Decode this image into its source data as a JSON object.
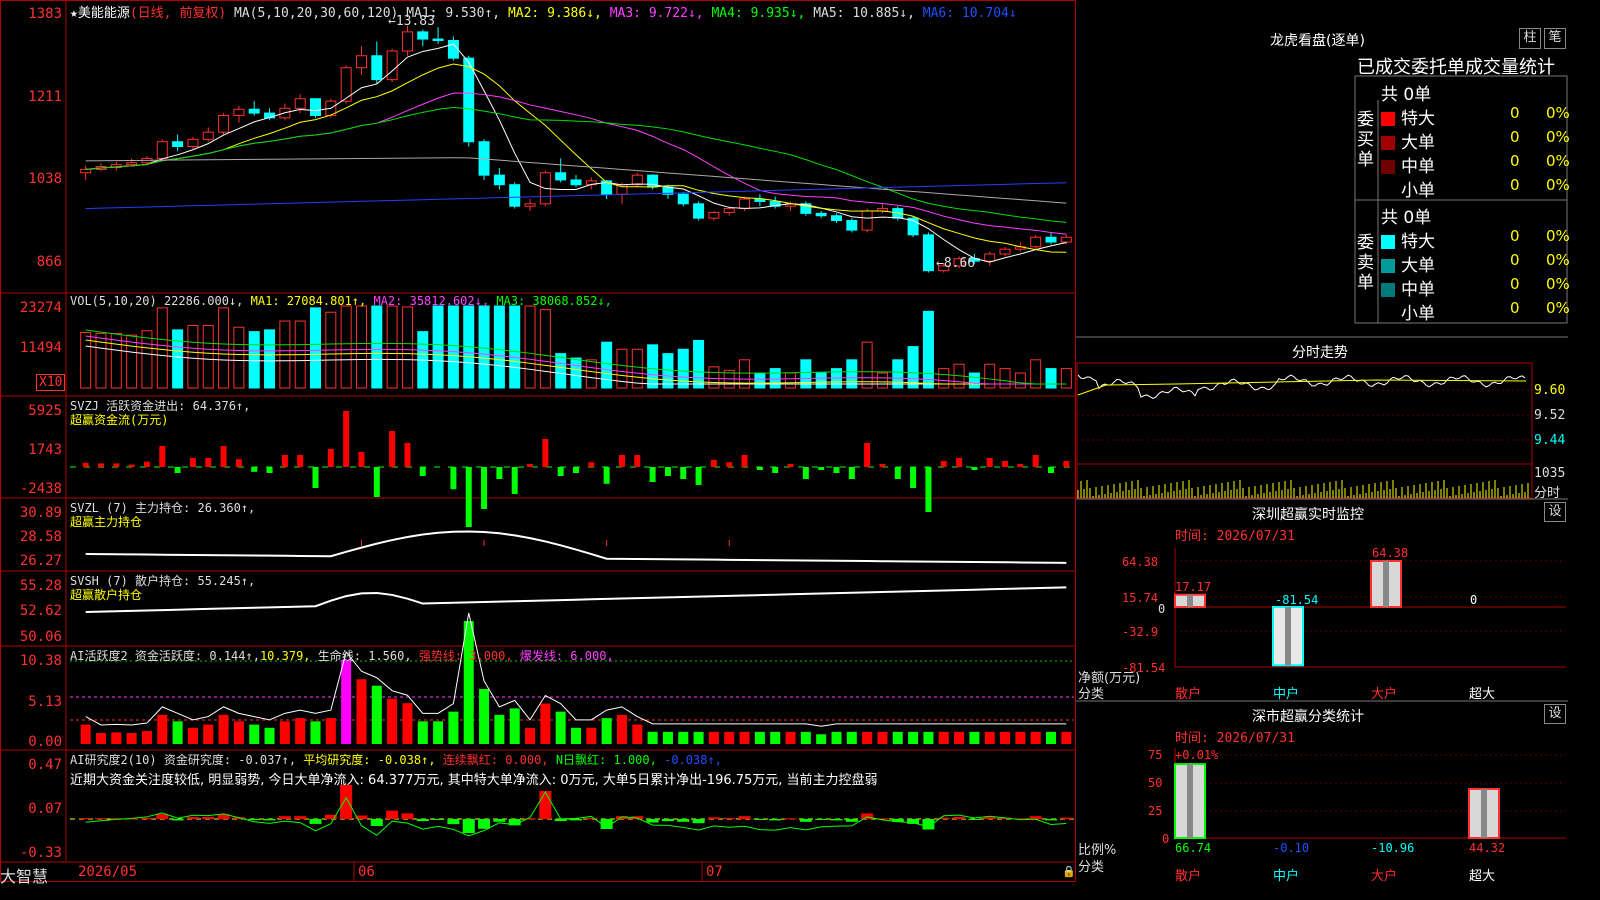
{
  "stock": {
    "name": "美能能源",
    "period": "(日线, 前复权)",
    "ma_caption": "MA(5,10,20,30,60,120)",
    "ma1": "MA1: 9.530↑,",
    "ma2": "MA2: 9.386↓,",
    "ma3": "MA3: 9.722↓,",
    "ma4": "MA4: 9.935↓,",
    "ma5": "MA5: 10.885↓,",
    "ma6": "MA6: 10.704↓",
    "high_mark": "13.83",
    "low_mark": "8.66"
  },
  "price_axis": [
    "1383",
    "1211",
    "1038",
    "866"
  ],
  "vol": {
    "caption": "VOL(5,10,20)",
    "value": "22286.000↓,",
    "ma1": "MA1: 27084.801↑,",
    "ma2": "MA2: 35812.602↓,",
    "ma3": "MA3: 38068.852↓,",
    "axis": [
      "23274",
      "11494"
    ],
    "unit": "X10"
  },
  "svzj": {
    "caption": "SVZJ",
    "title": "活跃资金进出: 64.376↑,",
    "subtitle": "超赢资金流(万元)",
    "axis": [
      "5925",
      "1743",
      "-2438"
    ]
  },
  "svzl": {
    "caption": "SVZL (7)",
    "title": "主力持仓: 26.360↑,",
    "subtitle": "超赢主力持仓",
    "axis": [
      "30.89",
      "28.58",
      "26.27"
    ]
  },
  "svsh": {
    "caption": "SVSH (7)",
    "title": "散户持仓: 55.245↑,",
    "subtitle": "超赢散户持仓",
    "axis": [
      "55.28",
      "52.62",
      "50.06"
    ]
  },
  "ai_active": {
    "caption": "AI活跃度2",
    "t1": "资金活跃度: 0.144↑,",
    "t2": "10.379,",
    "t3": "生命线: 1.560,",
    "t4": "强势线: 3.000,",
    "t5": "爆发线: 6.000,",
    "axis": [
      "10.38",
      "5.13",
      "0.00"
    ]
  },
  "ai_research": {
    "caption": "AI研究度2(10)",
    "t1": "资金研究度: -0.037↑,",
    "t2": "平均研究度: -0.038↑,",
    "t3": "连续飘红: 0.000,",
    "t4": "N日飘红: 1.000,",
    "t5": "-0.038↑,",
    "comment": "近期大资金关注度较低, 明显弱势, 今日大单净流入: 64.377万元, 其中特大单净流入: 0万元, 大单5日累计净出-196.75万元, 当前主力控盘弱",
    "axis": [
      "0.47",
      "0.07",
      "-0.33"
    ]
  },
  "date_axis": [
    "2026/05",
    "06",
    "07"
  ],
  "brand": "大智慧",
  "lhb": {
    "title": "龙虎看盘(逐单)",
    "btn1": "柱",
    "btn2": "笔",
    "tabs": "已成交委托单成交量统计",
    "buy_total": "共 0单",
    "buy_label": "委买单",
    "sell_total": "共 0单",
    "sell_label": "委卖单",
    "buy_rows": [
      {
        "name": "特大",
        "val": "0",
        "pct": "0%",
        "color": "#ff0000"
      },
      {
        "name": "大单",
        "val": "0",
        "pct": "0%",
        "color": "#a00000"
      },
      {
        "name": "中单",
        "val": "0",
        "pct": "0%",
        "color": "#700000"
      },
      {
        "name": "小单",
        "val": "0",
        "pct": "0%",
        "color": ""
      }
    ],
    "sell_rows": [
      {
        "name": "特大",
        "val": "0",
        "pct": "0%",
        "color": "#00ffff"
      },
      {
        "name": "大单",
        "val": "0",
        "pct": "0%",
        "color": "#009a9a"
      },
      {
        "name": "中单",
        "val": "0",
        "pct": "0%",
        "color": "#007a7a"
      },
      {
        "name": "小单",
        "val": "0",
        "pct": "0%",
        "color": ""
      }
    ]
  },
  "intraday": {
    "title": "分时走势",
    "axis": [
      "9.60",
      "9.52",
      "9.44"
    ],
    "vol_axis": [
      "1035",
      "分时"
    ]
  },
  "monitor": {
    "title": "深圳超赢实时监控",
    "btn": "设",
    "time": "时间: 2026/07/31",
    "unit": "净额(万元)",
    "category": "分类",
    "axis": [
      "64.38",
      "15.74",
      "0",
      "-32.9",
      "-81.54"
    ],
    "cats": [
      "散户",
      "中户",
      "大户",
      "超大"
    ],
    "values": [
      17.17,
      -81.54,
      64.38,
      0
    ],
    "labels": [
      "17.17",
      "-81.54",
      "64.38",
      "0"
    ]
  },
  "classify": {
    "title": "深市超赢分类统计",
    "btn": "设",
    "time": "时间: 2026/07/31",
    "unit": "比例%",
    "category": "分类",
    "top_label": "+0.01%",
    "axis": [
      "75",
      "50",
      "25",
      "0"
    ],
    "cats": [
      "散户",
      "中户",
      "大户",
      "超大"
    ],
    "values": [
      66.74,
      -0.1,
      -10.96,
      44.32
    ],
    "labels": [
      "66.74",
      "-0.10",
      "-10.96",
      "44.32"
    ]
  },
  "chart_data": [
    {
      "type": "candlestick",
      "title": "美能能源 (日线, 前复权)",
      "ohlc": [
        [
          10.75,
          10.9,
          10.6,
          10.82
        ],
        [
          10.82,
          10.95,
          10.78,
          10.88
        ],
        [
          10.86,
          10.98,
          10.8,
          10.92
        ],
        [
          10.92,
          11.05,
          10.88,
          10.96
        ],
        [
          10.96,
          11.1,
          10.9,
          11.05
        ],
        [
          11.05,
          11.45,
          11.0,
          11.4
        ],
        [
          11.4,
          11.55,
          11.2,
          11.3
        ],
        [
          11.3,
          11.5,
          11.25,
          11.45
        ],
        [
          11.45,
          11.7,
          11.4,
          11.6
        ],
        [
          11.6,
          12.0,
          11.55,
          11.95
        ],
        [
          11.95,
          12.15,
          11.8,
          12.08
        ],
        [
          12.08,
          12.25,
          11.95,
          12.0
        ],
        [
          12.0,
          12.1,
          11.85,
          11.9
        ],
        [
          11.9,
          12.2,
          11.85,
          12.1
        ],
        [
          12.1,
          12.4,
          12.0,
          12.3
        ],
        [
          12.3,
          12.25,
          11.9,
          11.95
        ],
        [
          11.95,
          12.3,
          11.9,
          12.25
        ],
        [
          12.25,
          13.0,
          12.2,
          12.95
        ],
        [
          12.95,
          13.4,
          12.8,
          13.2
        ],
        [
          13.2,
          13.5,
          12.6,
          12.7
        ],
        [
          12.7,
          13.35,
          12.65,
          13.3
        ],
        [
          13.3,
          13.83,
          13.2,
          13.7
        ],
        [
          13.7,
          13.75,
          13.4,
          13.55
        ],
        [
          13.55,
          13.8,
          13.45,
          13.52
        ],
        [
          13.52,
          13.6,
          13.1,
          13.15
        ],
        [
          13.15,
          13.2,
          11.3,
          11.4
        ],
        [
          11.4,
          11.45,
          10.6,
          10.7
        ],
        [
          10.7,
          10.85,
          10.4,
          10.5
        ],
        [
          10.5,
          10.55,
          10.0,
          10.05
        ],
        [
          10.05,
          10.2,
          9.95,
          10.1
        ],
        [
          10.1,
          10.8,
          10.05,
          10.75
        ],
        [
          10.75,
          11.05,
          10.55,
          10.6
        ],
        [
          10.6,
          10.7,
          10.45,
          10.5
        ],
        [
          10.5,
          10.65,
          10.4,
          10.58
        ],
        [
          10.58,
          10.6,
          10.2,
          10.3
        ],
        [
          10.3,
          10.55,
          10.1,
          10.5
        ],
        [
          10.5,
          10.75,
          10.45,
          10.7
        ],
        [
          10.7,
          10.72,
          10.4,
          10.45
        ],
        [
          10.45,
          10.5,
          10.2,
          10.3
        ],
        [
          10.3,
          10.35,
          10.05,
          10.1
        ],
        [
          10.1,
          10.15,
          9.75,
          9.8
        ],
        [
          9.8,
          9.95,
          9.75,
          9.92
        ],
        [
          9.92,
          10.05,
          9.85,
          10.0
        ],
        [
          10.0,
          10.25,
          9.95,
          10.2
        ],
        [
          10.2,
          10.3,
          10.05,
          10.15
        ],
        [
          10.15,
          10.25,
          10.0,
          10.05
        ],
        [
          10.05,
          10.15,
          9.95,
          10.1
        ],
        [
          10.1,
          10.15,
          9.85,
          9.9
        ],
        [
          9.9,
          9.95,
          9.8,
          9.85
        ],
        [
          9.85,
          9.9,
          9.7,
          9.75
        ],
        [
          9.75,
          9.8,
          9.5,
          9.55
        ],
        [
          9.55,
          10.0,
          9.5,
          9.95
        ],
        [
          9.95,
          10.1,
          9.9,
          10.0
        ],
        [
          10.0,
          10.05,
          9.75,
          9.8
        ],
        [
          9.8,
          9.85,
          9.4,
          9.45
        ],
        [
          9.45,
          9.5,
          8.66,
          8.7
        ],
        [
          8.7,
          8.85,
          8.66,
          8.8
        ],
        [
          8.8,
          9.0,
          8.75,
          8.95
        ],
        [
          8.95,
          9.05,
          8.85,
          8.9
        ],
        [
          8.9,
          9.1,
          8.8,
          9.05
        ],
        [
          9.05,
          9.2,
          9.0,
          9.15
        ],
        [
          9.15,
          9.3,
          9.1,
          9.2
        ],
        [
          9.2,
          9.45,
          9.15,
          9.4
        ],
        [
          9.4,
          9.5,
          9.25,
          9.3
        ],
        [
          9.3,
          9.45,
          9.25,
          9.4
        ]
      ],
      "ylim": [
        8.4,
        14.2
      ]
    }
  ]
}
